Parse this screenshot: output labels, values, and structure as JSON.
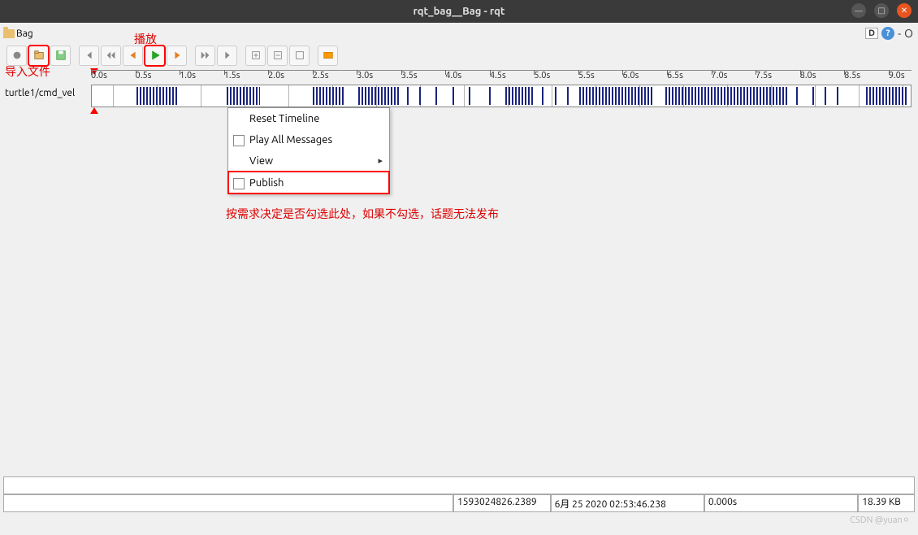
{
  "window": {
    "title": "rqt_bag__Bag - rqt"
  },
  "toolbar": {
    "bag_label": "Bag",
    "d_badge": "D",
    "help": "?",
    "minus": "-",
    "o": "O"
  },
  "annotations": {
    "play": "播放",
    "import_file": "导入文件",
    "publish_note": "按需求决定是否勾选此处，如果不勾选，话题无法发布"
  },
  "timeline": {
    "ticks": [
      "0.0s",
      "0.5s",
      "1.0s",
      "1.5s",
      "2.0s",
      "2.5s",
      "3.0s",
      "3.5s",
      "4.0s",
      "4.5s",
      "5.0s",
      "5.5s",
      "6.0s",
      "6.5s",
      "7.0s",
      "7.5s",
      "8.0s",
      "8.5s",
      "9.0s"
    ],
    "topic": "turtle1/cmd_vel"
  },
  "context_menu": {
    "reset": "Reset Timeline",
    "play_all": "Play All Messages",
    "view": "View",
    "publish": "Publish"
  },
  "status": {
    "timestamp": "1593024826.2389",
    "datetime": "6月 25 2020 02:53:46.238",
    "elapsed": "0.000s",
    "filesize": "18.39 KB"
  },
  "watermark": "CSDN @yuan⚪"
}
